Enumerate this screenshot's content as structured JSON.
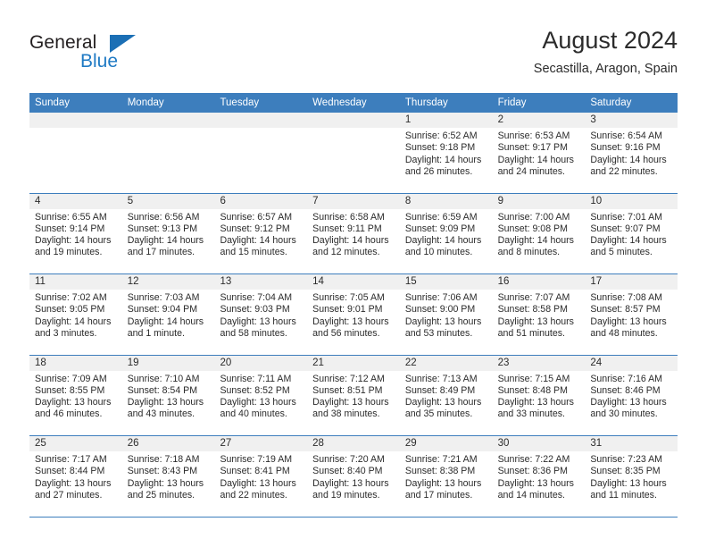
{
  "brand": {
    "name_part1": "General",
    "name_part2": "Blue",
    "flag_icon": "triangle-flag-icon"
  },
  "header": {
    "title": "August 2024",
    "subtitle": "Secastilla, Aragon, Spain"
  },
  "colors": {
    "header_blue": "#3d7ebd",
    "day_number_bg": "#f0f0f0",
    "brand_blue": "#1f7ac4",
    "text": "#2b2b2b"
  },
  "calendar": {
    "weekday_headers": [
      "Sunday",
      "Monday",
      "Tuesday",
      "Wednesday",
      "Thursday",
      "Friday",
      "Saturday"
    ],
    "weeks": [
      [
        {
          "day": "",
          "sunrise": "",
          "sunset": "",
          "daylight1": "",
          "daylight2": ""
        },
        {
          "day": "",
          "sunrise": "",
          "sunset": "",
          "daylight1": "",
          "daylight2": ""
        },
        {
          "day": "",
          "sunrise": "",
          "sunset": "",
          "daylight1": "",
          "daylight2": ""
        },
        {
          "day": "",
          "sunrise": "",
          "sunset": "",
          "daylight1": "",
          "daylight2": ""
        },
        {
          "day": "1",
          "sunrise": "Sunrise: 6:52 AM",
          "sunset": "Sunset: 9:18 PM",
          "daylight1": "Daylight: 14 hours",
          "daylight2": "and 26 minutes."
        },
        {
          "day": "2",
          "sunrise": "Sunrise: 6:53 AM",
          "sunset": "Sunset: 9:17 PM",
          "daylight1": "Daylight: 14 hours",
          "daylight2": "and 24 minutes."
        },
        {
          "day": "3",
          "sunrise": "Sunrise: 6:54 AM",
          "sunset": "Sunset: 9:16 PM",
          "daylight1": "Daylight: 14 hours",
          "daylight2": "and 22 minutes."
        }
      ],
      [
        {
          "day": "4",
          "sunrise": "Sunrise: 6:55 AM",
          "sunset": "Sunset: 9:14 PM",
          "daylight1": "Daylight: 14 hours",
          "daylight2": "and 19 minutes."
        },
        {
          "day": "5",
          "sunrise": "Sunrise: 6:56 AM",
          "sunset": "Sunset: 9:13 PM",
          "daylight1": "Daylight: 14 hours",
          "daylight2": "and 17 minutes."
        },
        {
          "day": "6",
          "sunrise": "Sunrise: 6:57 AM",
          "sunset": "Sunset: 9:12 PM",
          "daylight1": "Daylight: 14 hours",
          "daylight2": "and 15 minutes."
        },
        {
          "day": "7",
          "sunrise": "Sunrise: 6:58 AM",
          "sunset": "Sunset: 9:11 PM",
          "daylight1": "Daylight: 14 hours",
          "daylight2": "and 12 minutes."
        },
        {
          "day": "8",
          "sunrise": "Sunrise: 6:59 AM",
          "sunset": "Sunset: 9:09 PM",
          "daylight1": "Daylight: 14 hours",
          "daylight2": "and 10 minutes."
        },
        {
          "day": "9",
          "sunrise": "Sunrise: 7:00 AM",
          "sunset": "Sunset: 9:08 PM",
          "daylight1": "Daylight: 14 hours",
          "daylight2": "and 8 minutes."
        },
        {
          "day": "10",
          "sunrise": "Sunrise: 7:01 AM",
          "sunset": "Sunset: 9:07 PM",
          "daylight1": "Daylight: 14 hours",
          "daylight2": "and 5 minutes."
        }
      ],
      [
        {
          "day": "11",
          "sunrise": "Sunrise: 7:02 AM",
          "sunset": "Sunset: 9:05 PM",
          "daylight1": "Daylight: 14 hours",
          "daylight2": "and 3 minutes."
        },
        {
          "day": "12",
          "sunrise": "Sunrise: 7:03 AM",
          "sunset": "Sunset: 9:04 PM",
          "daylight1": "Daylight: 14 hours",
          "daylight2": "and 1 minute."
        },
        {
          "day": "13",
          "sunrise": "Sunrise: 7:04 AM",
          "sunset": "Sunset: 9:03 PM",
          "daylight1": "Daylight: 13 hours",
          "daylight2": "and 58 minutes."
        },
        {
          "day": "14",
          "sunrise": "Sunrise: 7:05 AM",
          "sunset": "Sunset: 9:01 PM",
          "daylight1": "Daylight: 13 hours",
          "daylight2": "and 56 minutes."
        },
        {
          "day": "15",
          "sunrise": "Sunrise: 7:06 AM",
          "sunset": "Sunset: 9:00 PM",
          "daylight1": "Daylight: 13 hours",
          "daylight2": "and 53 minutes."
        },
        {
          "day": "16",
          "sunrise": "Sunrise: 7:07 AM",
          "sunset": "Sunset: 8:58 PM",
          "daylight1": "Daylight: 13 hours",
          "daylight2": "and 51 minutes."
        },
        {
          "day": "17",
          "sunrise": "Sunrise: 7:08 AM",
          "sunset": "Sunset: 8:57 PM",
          "daylight1": "Daylight: 13 hours",
          "daylight2": "and 48 minutes."
        }
      ],
      [
        {
          "day": "18",
          "sunrise": "Sunrise: 7:09 AM",
          "sunset": "Sunset: 8:55 PM",
          "daylight1": "Daylight: 13 hours",
          "daylight2": "and 46 minutes."
        },
        {
          "day": "19",
          "sunrise": "Sunrise: 7:10 AM",
          "sunset": "Sunset: 8:54 PM",
          "daylight1": "Daylight: 13 hours",
          "daylight2": "and 43 minutes."
        },
        {
          "day": "20",
          "sunrise": "Sunrise: 7:11 AM",
          "sunset": "Sunset: 8:52 PM",
          "daylight1": "Daylight: 13 hours",
          "daylight2": "and 40 minutes."
        },
        {
          "day": "21",
          "sunrise": "Sunrise: 7:12 AM",
          "sunset": "Sunset: 8:51 PM",
          "daylight1": "Daylight: 13 hours",
          "daylight2": "and 38 minutes."
        },
        {
          "day": "22",
          "sunrise": "Sunrise: 7:13 AM",
          "sunset": "Sunset: 8:49 PM",
          "daylight1": "Daylight: 13 hours",
          "daylight2": "and 35 minutes."
        },
        {
          "day": "23",
          "sunrise": "Sunrise: 7:15 AM",
          "sunset": "Sunset: 8:48 PM",
          "daylight1": "Daylight: 13 hours",
          "daylight2": "and 33 minutes."
        },
        {
          "day": "24",
          "sunrise": "Sunrise: 7:16 AM",
          "sunset": "Sunset: 8:46 PM",
          "daylight1": "Daylight: 13 hours",
          "daylight2": "and 30 minutes."
        }
      ],
      [
        {
          "day": "25",
          "sunrise": "Sunrise: 7:17 AM",
          "sunset": "Sunset: 8:44 PM",
          "daylight1": "Daylight: 13 hours",
          "daylight2": "and 27 minutes."
        },
        {
          "day": "26",
          "sunrise": "Sunrise: 7:18 AM",
          "sunset": "Sunset: 8:43 PM",
          "daylight1": "Daylight: 13 hours",
          "daylight2": "and 25 minutes."
        },
        {
          "day": "27",
          "sunrise": "Sunrise: 7:19 AM",
          "sunset": "Sunset: 8:41 PM",
          "daylight1": "Daylight: 13 hours",
          "daylight2": "and 22 minutes."
        },
        {
          "day": "28",
          "sunrise": "Sunrise: 7:20 AM",
          "sunset": "Sunset: 8:40 PM",
          "daylight1": "Daylight: 13 hours",
          "daylight2": "and 19 minutes."
        },
        {
          "day": "29",
          "sunrise": "Sunrise: 7:21 AM",
          "sunset": "Sunset: 8:38 PM",
          "daylight1": "Daylight: 13 hours",
          "daylight2": "and 17 minutes."
        },
        {
          "day": "30",
          "sunrise": "Sunrise: 7:22 AM",
          "sunset": "Sunset: 8:36 PM",
          "daylight1": "Daylight: 13 hours",
          "daylight2": "and 14 minutes."
        },
        {
          "day": "31",
          "sunrise": "Sunrise: 7:23 AM",
          "sunset": "Sunset: 8:35 PM",
          "daylight1": "Daylight: 13 hours",
          "daylight2": "and 11 minutes."
        }
      ]
    ]
  }
}
